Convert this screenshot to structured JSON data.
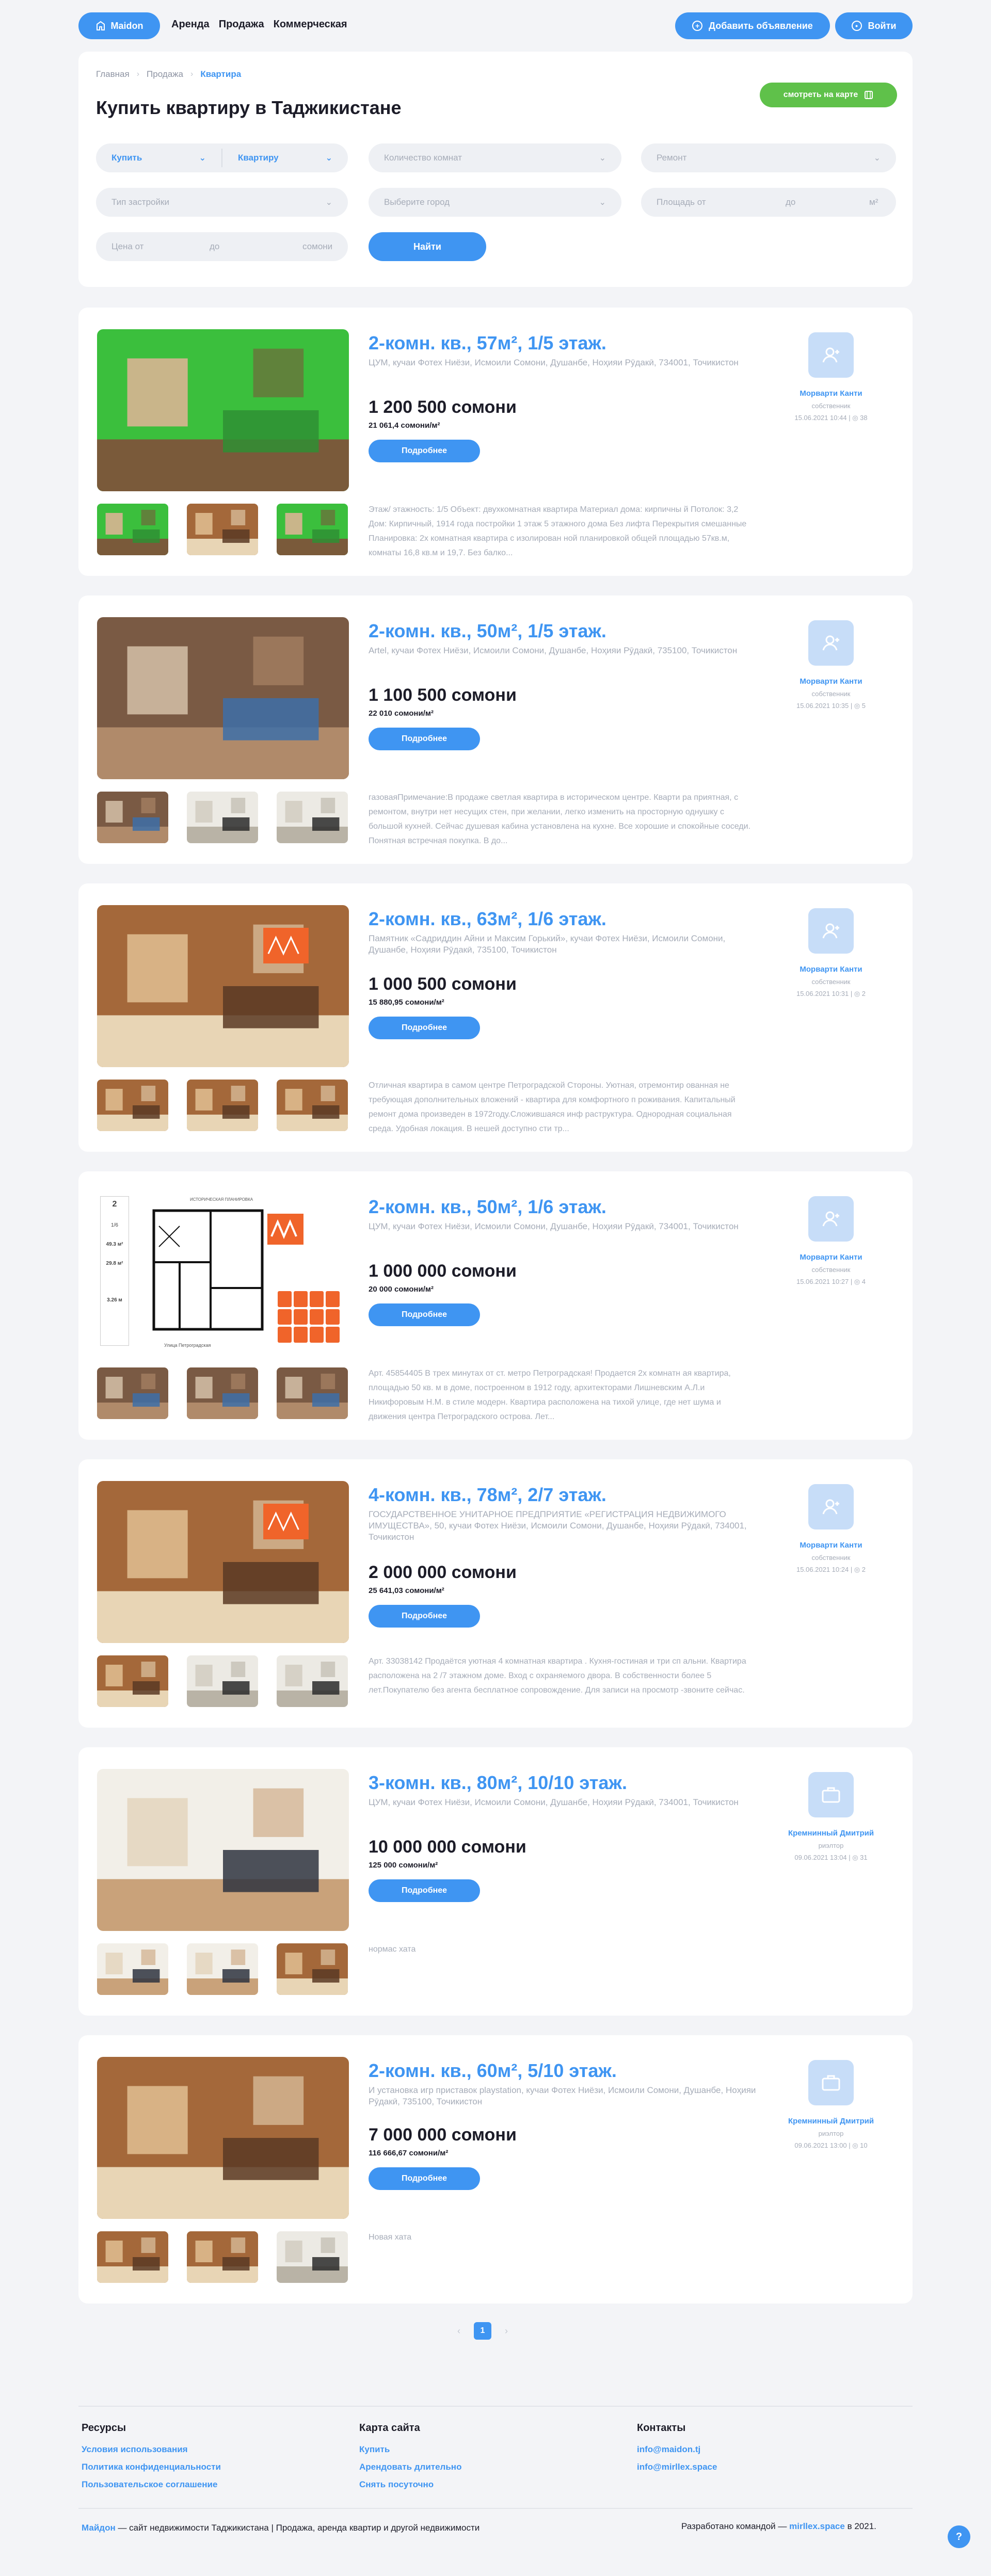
{
  "header": {
    "logo_text": "Maidon",
    "nav": [
      "Аренда",
      "Продажа",
      "Коммерческая"
    ],
    "add_listing_label": "Добавить объявление",
    "login_label": "Войти"
  },
  "breadcrumb": [
    "Главная",
    "Продажа",
    "Квартира"
  ],
  "page_title": "Купить квартиру в Таджикистане",
  "map_button_label": "смотреть на карте",
  "filters": {
    "deal_type": "Купить",
    "property_type": "Квартиру",
    "rooms_placeholder": "Количество комнат",
    "renovation_placeholder": "Ремонт",
    "building_type_placeholder": "Тип застройки",
    "city_placeholder": "Выберите город",
    "area_from_placeholder": "Площадь от",
    "area_to_placeholder": "до",
    "area_unit": "м²",
    "price_from_placeholder": "Цена от",
    "price_to_placeholder": "до",
    "price_unit": "сомони",
    "search_label": "Найти"
  },
  "more_label": "Подробнее",
  "listings": [
    {
      "title": "2-комн. кв., 57м², 1/5 этаж.",
      "address": "ЦУМ, кучаи Фотех Ниёзи, Исмоили Сомони, Душанбе, Ноҳияи Рӯдакӣ, 734001, Точикистон",
      "price": "1 200 500 сомони",
      "price_per_m2": "21 061,4 сомони/м²",
      "description": "Этаж/ этажность: 1/5 Объект: двухкомнатная квартира Материал дома: кирпичны й Потолок: 3,2 Дом: Кирпичный, 1914 года постройки 1 этаж 5 этажного дома Без лифта Перекрытия смешанные Планировка: 2х комнатная квартира с изолирован ной планировкой общей площадью 57кв.м, комнаты 16,8 кв.м и 19,7. Без балко...",
      "seller": "Морварти Канти",
      "role": "собственник",
      "date": "15.06.2021 10:44",
      "views": "38",
      "photos": [
        "green-room",
        "wood-room",
        "green-room"
      ]
    },
    {
      "title": "2-комн. кв., 50м², 1/5 этаж.",
      "address": "Artel, кучаи Фотех Ниёзи, Исмоили Сомони, Душанбе, Ноҳияи Рӯдакӣ, 735100, Точикистон",
      "price": "1 100 500 сомони",
      "price_per_m2": "22 010 сомони/м²",
      "description": "газоваяПримечание:В продаже светлая квартира в историческом центре. Кварти ра приятная, с ремонтом, внутри нет несущих стен, при желании, легко изменить на просторную однушку с большой кухней. Сейчас душевая кабина установлена на кухне. Все хорошие и спокойные соседи. Понятная встречная покупка. В до...",
      "seller": "Морварти Канти",
      "role": "собственник",
      "date": "15.06.2021 10:35",
      "views": "5",
      "photos": [
        "building",
        "white-room",
        "white-room"
      ]
    },
    {
      "title": "2-комн. кв., 63м², 1/6 этаж.",
      "address": "Памятник «Садриддин Айни и Максим Горький», кучаи Фотех Ниёзи, Исмоили Сомони, Душанбе, Ноҳияи Рӯдакӣ, 735100, Точикистон",
      "price": "1 000 500 сомони",
      "price_per_m2": "15 880,95 сомони/м²",
      "description": "Отличная квартира в самом центре Петроградской Стороны. Уютная, отремонтир ованная не требующая дополнительных вложений - квартира для комфортного п роживания. Капитальный ремонт дома произведен в 1972году.Сложившаяся инф раструктура. Однородная социальная среда. Удобная локация. В нешей доступно сти тр...",
      "seller": "Морварти Канти",
      "role": "собственник",
      "date": "15.06.2021 10:31",
      "views": "2",
      "photos": [
        "wood-room",
        "wood-room",
        "wood-room"
      ]
    },
    {
      "title": "2-комн. кв., 50м², 1/6 этаж.",
      "address": "ЦУМ, кучаи Фотех Ниёзи, Исмоили Сомони, Душанбе, Ноҳияи Рӯдакӣ, 734001, Точикистон",
      "price": "1 000 000 сомони",
      "price_per_m2": "20 000 сомони/м²",
      "description": "Арт. 45854405 В трех минутах от ст. метро Петроградская! Продается 2х комнатн ая квартира, площадью 50 кв. м в доме, построенном в 1912 году, архитекторами Лишневским А.Л.и Никифоровым Н.М. в стиле модерн. Квартира расположена на тихой улице, где нет шума и движения центра Петроградского острова. Лет...",
      "seller": "Морварти Канти",
      "role": "собственник",
      "date": "15.06.2021 10:27",
      "views": "4",
      "floorplan": {
        "label_window": "ИСТОРИЧЕСКАЯ ПЛАНИРОВКА",
        "floor": "2",
        "floors_total": "1/6",
        "area_total": "49.3 м²",
        "area_living": "29.8 м²",
        "height": "3.26 м",
        "street": "Улица Петроградская"
      },
      "photos": [
        "building",
        "building",
        "building"
      ]
    },
    {
      "title": "4-комн. кв., 78м², 2/7 этаж.",
      "address": "ГОСУДАРСТВЕННОЕ УНИТАРНОЕ ПРЕДПРИЯТИЕ «РЕГИСТРАЦИЯ НЕДВИЖИМОГО ИМУЩЕСТВА», 50, кучаи Фотех Ниёзи, Исмоили Сомони, Душанбе, Ноҳияи Рӯдакӣ, 734001, Точикистон",
      "price": "2 000 000 сомони",
      "price_per_m2": "25 641,03 сомони/м²",
      "description": "Арт. 33038142 Продаётся уютная 4 комнатная квартира . Кухня-гостиная и три сп альни. Квартира расположена на 2 /7 этажном доме. Вход с охраняемого двора. В собственности более 5 лет.Покупателю без агента бесплатное сопровождение. Для записи на просмотр -звоните сейчас.",
      "seller": "Морварти Канти",
      "role": "собственник",
      "date": "15.06.2021 10:24",
      "views": "2",
      "photos": [
        "wood-room",
        "white-room",
        "white-room"
      ]
    },
    {
      "title": "3-комн. кв., 80м², 10/10 этаж.",
      "address": "ЦУМ, кучаи Фотех Ниёзи, Исмоили Сомони, Душанбе, Ноҳияи Рӯдакӣ, 734001, Точикистон",
      "price": "10 000 000 сомони",
      "price_per_m2": "125 000 сомони/м²",
      "description": "нормас хата",
      "seller": "Кремнинный Дмитрий",
      "role": "риэлтор",
      "date": "09.06.2021 13:04",
      "views": "31",
      "photos": [
        "bright-room",
        "bright-room",
        "wood-room"
      ]
    },
    {
      "title": "2-комн. кв., 60м², 5/10 этаж.",
      "address": "И установка игр приставок playstation, кучаи Фотех Ниёзи, Исмоили Сомони, Душанбе, Ноҳияи Рӯдакӣ, 735100, Точикистон",
      "price": "7 000 000 сомони",
      "price_per_m2": "116 666,67 сомони/м²",
      "description": "Новая хата",
      "seller": "Кремнинный Дмитрий",
      "role": "риэлтор",
      "date": "09.06.2021 13:00",
      "views": "10",
      "photos": [
        "wood-room",
        "wood-room",
        "white-room"
      ]
    }
  ],
  "pagination": {
    "prev": "‹",
    "current": "1",
    "next": "›"
  },
  "footer": {
    "resources_title": "Ресурсы",
    "resources": [
      "Условия использования",
      "Политика конфиденциальности",
      "Пользовательское соглашение"
    ],
    "sitemap_title": "Карта сайта",
    "sitemap": [
      "Купить",
      "Арендовать длительно",
      "Снять посуточно"
    ],
    "contacts_title": "Контакты",
    "contacts": [
      "info@maidon.tj",
      "info@mirllex.space"
    ],
    "copyright_brand": "Майдон",
    "copyright_text": " — сайт недвижимости Таджикистана | Продажа, аренда квартир и другой недвижимости",
    "developed_prefix": "Разработано командой — ",
    "developed_brand": "mirllex.space",
    "developed_suffix": " в 2021."
  },
  "colors": {
    "accent": "#3f95f2",
    "map_button": "#5fc14a",
    "background": "#f3f4f7",
    "muted_text": "#a6acb8"
  }
}
